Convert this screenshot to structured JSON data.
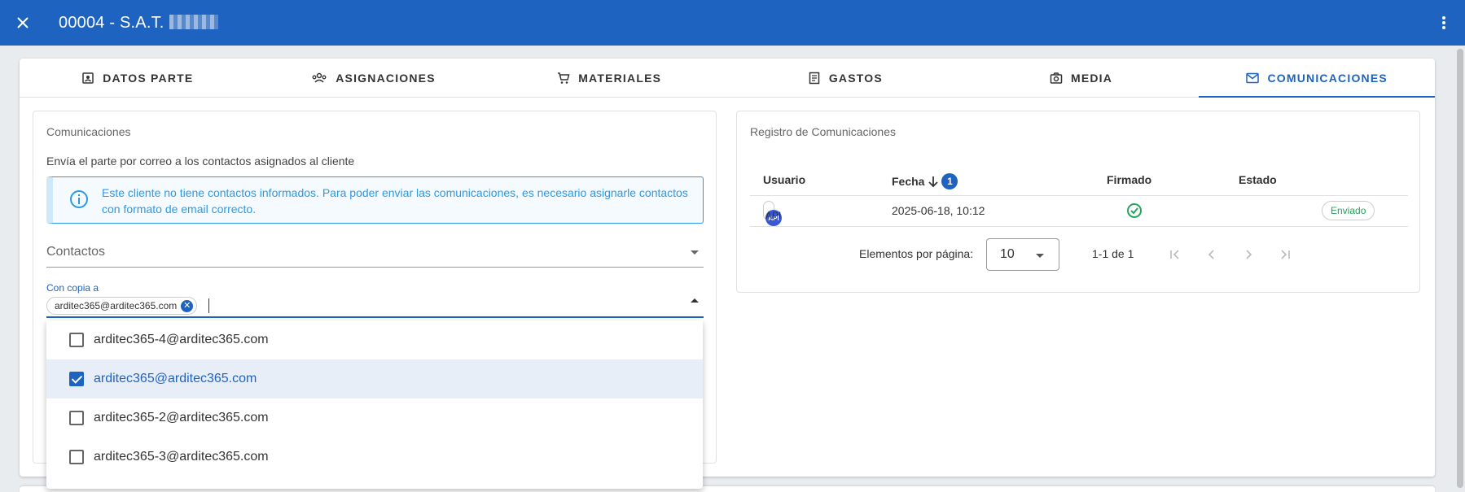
{
  "header": {
    "title": "00004 - S.A.T.",
    "bg_color": "#1e63c0"
  },
  "tabs": [
    {
      "label": "DATOS PARTE",
      "icon": "contact-card-icon"
    },
    {
      "label": "ASIGNACIONES",
      "icon": "group-icon"
    },
    {
      "label": "MATERIALES",
      "icon": "cart-icon"
    },
    {
      "label": "GASTOS",
      "icon": "receipt-icon"
    },
    {
      "label": "MEDIA",
      "icon": "camera-icon"
    },
    {
      "label": "COMUNICACIONES",
      "icon": "mail-icon",
      "active": true
    }
  ],
  "comunicaciones": {
    "title": "Comunicaciones",
    "description": "Envía el parte por correo a los contactos asignados al cliente",
    "alert": "Este cliente no tiene contactos informados. Para poder enviar las comunicaciones, es necesario asignarle contactos con formato de email correcto.",
    "contactos_label": "Contactos",
    "cc_label": "Con copia a",
    "cc_chip": "arditec365@arditec365.com",
    "options": [
      {
        "label": "arditec365-4@arditec365.com",
        "checked": false
      },
      {
        "label": "arditec365@arditec365.com",
        "checked": true
      },
      {
        "label": "arditec365-2@arditec365.com",
        "checked": false
      },
      {
        "label": "arditec365-3@arditec365.com",
        "checked": false
      }
    ]
  },
  "registro": {
    "title": "Registro de Comunicaciones",
    "columns": {
      "usuario": "Usuario",
      "fecha": "Fecha",
      "sort_badge": "1",
      "firmado": "Firmado",
      "estado": "Estado"
    },
    "rows": [
      {
        "avatar": "API",
        "usuario": "API",
        "fecha": "2025-06-18, 10:12",
        "estado": "Enviado"
      }
    ],
    "pager": {
      "label": "Elementos por página:",
      "page_size": "10",
      "range": "1-1 de 1"
    }
  }
}
